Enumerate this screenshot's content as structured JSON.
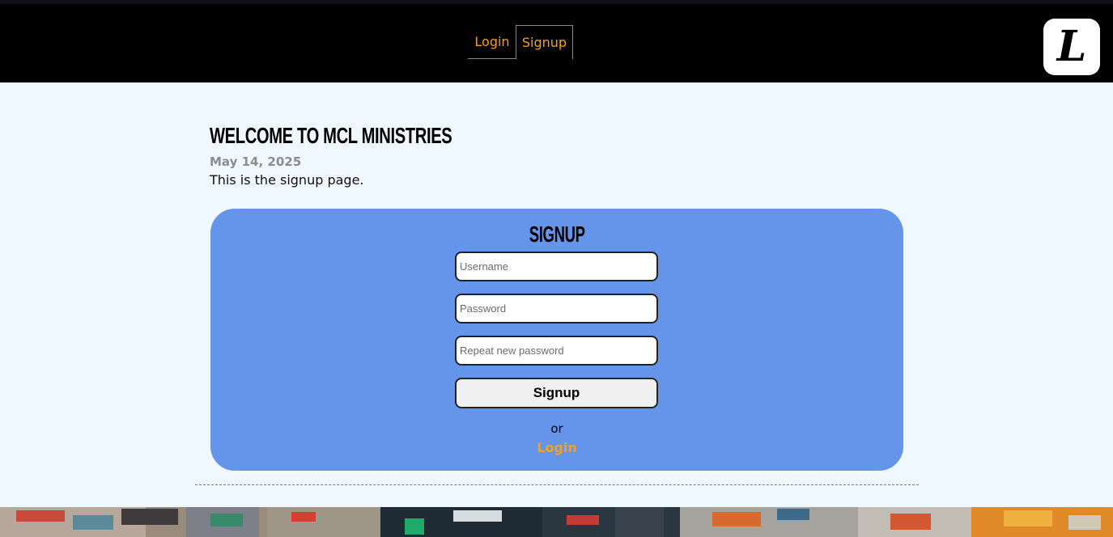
{
  "nav": {
    "login_label": "Login",
    "signup_label": "Signup"
  },
  "logo": {
    "letter": "L"
  },
  "page": {
    "title": "WELCOME TO MCL MINISTRIES",
    "date": "May 14, 2025",
    "intro": "This is the signup page."
  },
  "form": {
    "title": "SIGNUP",
    "username_placeholder": "Username",
    "password_placeholder": "Password",
    "repeat_placeholder": "Repeat new password",
    "submit_label": "Signup",
    "or_text": "or",
    "login_link": "Login"
  },
  "colors": {
    "accent": "#f5a214",
    "card": "#6495ea",
    "background": "#eff7ff",
    "header": "#000000"
  }
}
